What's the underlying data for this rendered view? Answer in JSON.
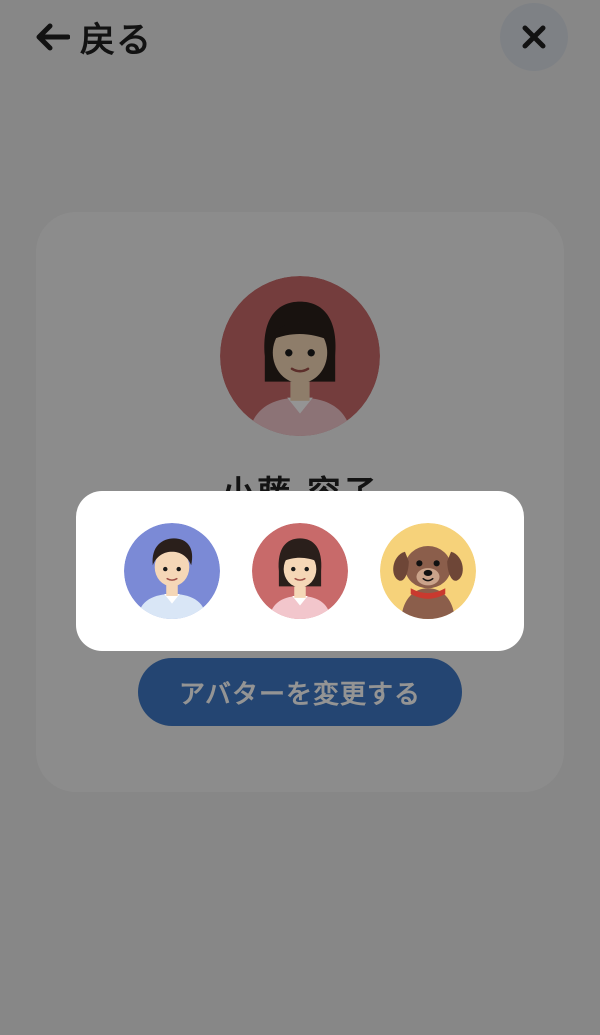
{
  "header": {
    "back_label": "戻る"
  },
  "profile": {
    "name": "小藤 容子"
  },
  "actions": {
    "change_avatar_label": "アバターを変更する"
  },
  "colors": {
    "button": "#3f78c4",
    "avatar_male_bg": "#7b8ad6",
    "avatar_female_bg": "#c86a6a",
    "avatar_dog_bg": "#f6d27a"
  },
  "icons": {
    "back": "arrow-left-icon",
    "close": "close-icon"
  },
  "avatar_options": [
    {
      "kind": "male-avatar"
    },
    {
      "kind": "female-avatar"
    },
    {
      "kind": "dog-avatar"
    }
  ]
}
